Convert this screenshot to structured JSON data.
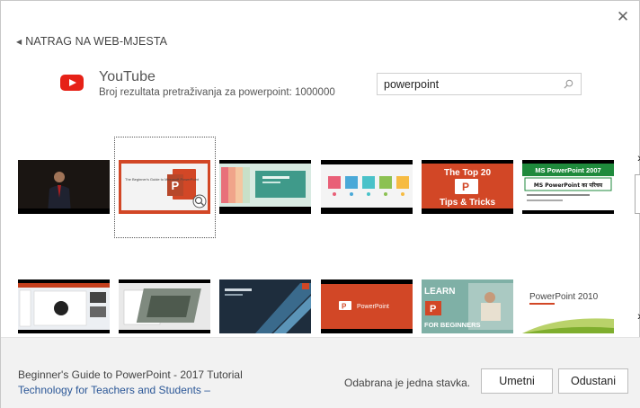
{
  "dialog": {
    "back_label": "NATRAG NA WEB-MJESTA",
    "provider": "YouTube",
    "results_text": "Broj rezultata pretraživanja za powerpoint: 1000000",
    "search": {
      "value": "powerpoint"
    }
  },
  "thumbnails": [
    {
      "caption": ""
    },
    {
      "caption": "The Beginner's Guide to Microsoft PowerPoint"
    },
    {
      "caption": ""
    },
    {
      "caption": ""
    },
    {
      "caption": "The Top 20",
      "caption2": "Tips & Tricks"
    },
    {
      "caption": "MS PowerPoint 2007",
      "caption2": "MS PowerPoint का परिचय"
    },
    {
      "caption": ""
    },
    {
      "caption": ""
    },
    {
      "caption": ""
    },
    {
      "caption": "PowerPoint"
    },
    {
      "caption": "LEARN",
      "caption2": "FOR BEGINNERS"
    },
    {
      "caption": "PowerPoint 2010"
    }
  ],
  "footer": {
    "video_title": "Beginner's Guide to PowerPoint - 2017 Tutorial",
    "video_author": "Technology for Teachers and Students –",
    "selection_status": "Odabrana je jedna stavka.",
    "insert_label": "Umetni",
    "cancel_label": "Odustani"
  },
  "colors": {
    "youtube_red": "#e62117",
    "powerpoint_orange": "#d24726",
    "link_blue": "#2b5797"
  }
}
